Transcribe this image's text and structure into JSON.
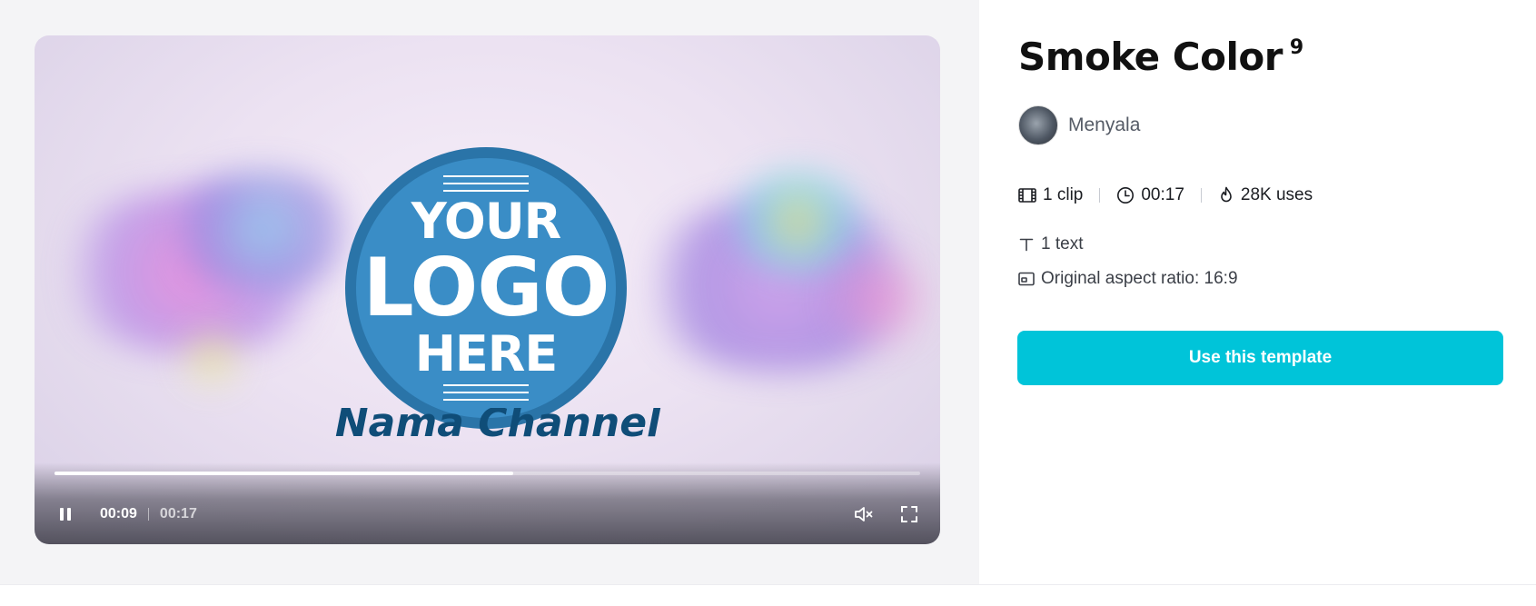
{
  "template": {
    "title": "Smoke Color",
    "title_badge": "9",
    "author": "Menyala",
    "stats": {
      "clips": "1 clip",
      "duration": "00:17",
      "uses": "28K uses"
    },
    "text_count": "1 text",
    "aspect_ratio": "Original aspect ratio: 16:9",
    "cta_label": "Use this template"
  },
  "video": {
    "logo_line1": "YOUR",
    "logo_line2": "LOGO",
    "logo_line3": "HERE",
    "channel_caption": "Nama Channel",
    "current_time": "00:09",
    "total_time": "00:17",
    "progress_fraction": 0.53,
    "muted": true
  },
  "icons": {
    "play_state": "pause-icon",
    "volume": "mute-icon",
    "fullscreen": "fullscreen-icon",
    "clip": "film-icon",
    "duration": "clock-icon",
    "uses": "flame-icon",
    "text": "text-icon",
    "ratio": "aspect-ratio-icon"
  },
  "colors": {
    "accent": "#00c4d9",
    "logo_blue": "#3a8dc6",
    "caption_blue": "#0f4d78"
  }
}
